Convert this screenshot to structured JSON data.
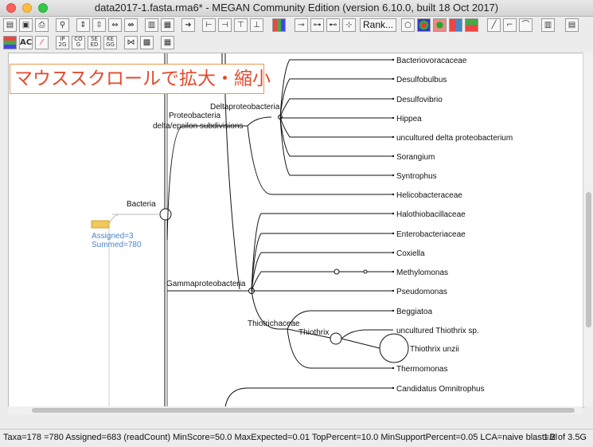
{
  "window": {
    "title": "data2017-1.fasta.rma6* - MEGAN Community Edition (version 6.10.0, built 18 Oct 2017)"
  },
  "toolbar": {
    "rank_label": "Rank..."
  },
  "overlay": {
    "text": "マウススクロールで拡大・縮小"
  },
  "tree": {
    "bacteria": "Bacteria",
    "proteobacteria": "Proteobacteria",
    "delta_epsilon": "delta/epsilon subdivisions",
    "deltaproteobacteria": "Deltaproteobacteria",
    "gammaproteobacteria": "Gammaproteobacteria",
    "thiotrichaceae": "Thiotrichaceae",
    "thiothrix": "Thiothrix",
    "assigned": "Assigned=3",
    "summed": "Summed=780",
    "leaves": [
      "Bacteriovoracaceae",
      "Desulfobulbus",
      "Desulfovibrio",
      "Hippea",
      "uncultured delta proteobacterium",
      "Sorangium",
      "Syntrophus",
      "Helicobacteraceae",
      "Halothiobacillaceae",
      "Enterobacteriaceae",
      "Coxiella",
      "Methylomonas",
      "Pseudomonas",
      "Beggiatoa",
      "uncultured Thiothrix sp.",
      "Thiothrix unzii",
      "Thermomonas",
      "Candidatus Omnitrophus"
    ]
  },
  "status": {
    "main": "Taxa=178    =780 Assigned=683 (readCount) MinScore=50.0 MaxExpected=0.01 TopPercent=10.0 MinSupportPercent=0.05 LCA=naive blast=Bl",
    "memory": "1.2 of 3.5G"
  }
}
